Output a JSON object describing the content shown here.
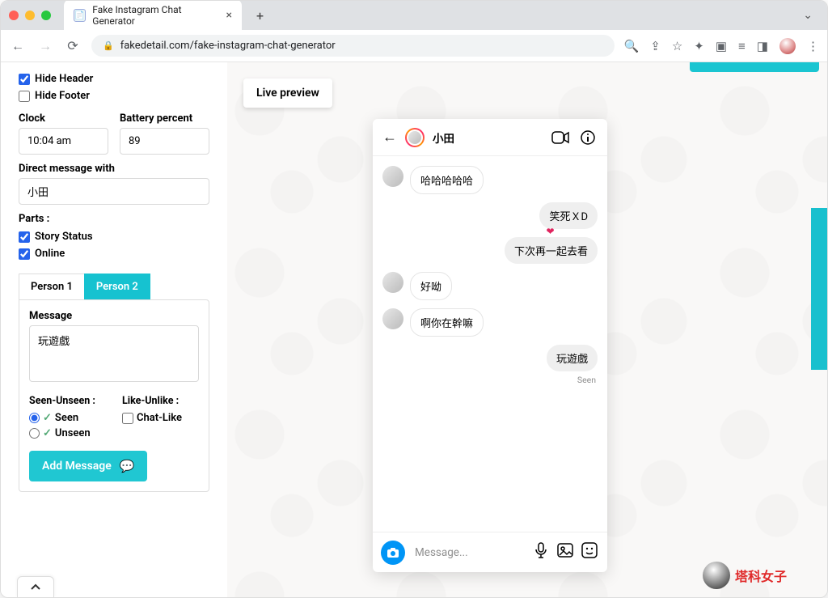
{
  "browser": {
    "tab_title": "Fake Instagram Chat Generator",
    "url_display": "fakedetail.com/fake-instagram-chat-generator"
  },
  "sidebar": {
    "hide_header_label": "Hide Header",
    "hide_header_checked": true,
    "hide_footer_label": "Hide Footer",
    "hide_footer_checked": false,
    "clock_label": "Clock",
    "clock_value": "10:04 am",
    "battery_label": "Battery percent",
    "battery_value": "89",
    "dm_label": "Direct message with",
    "dm_value": "小田",
    "parts_label": "Parts :",
    "story_status_label": "Story Status",
    "story_status_checked": true,
    "online_label": "Online",
    "online_checked": true,
    "tabs": {
      "person1": "Person 1",
      "person2": "Person 2",
      "active": "person2"
    },
    "message_label": "Message",
    "message_value": "玩遊戲",
    "seen_unseen_label": "Seen-Unseen :",
    "seen_label": "Seen",
    "unseen_label": "Unseen",
    "seen_selected": "seen",
    "like_unlike_label": "Like-Unlike :",
    "chat_like_label": "Chat-Like",
    "chat_like_checked": false,
    "add_message_label": "Add Message"
  },
  "preview": {
    "live_preview_label": "Live preview",
    "contact_name": "小田",
    "messages": [
      {
        "side": "in",
        "text": "哈哈哈哈哈"
      },
      {
        "side": "out",
        "text": "笑死ＸD",
        "liked": true
      },
      {
        "side": "out",
        "text": "下次再一起去看"
      },
      {
        "side": "in",
        "text": "好呦"
      },
      {
        "side": "in",
        "text": "啊你在幹嘛"
      },
      {
        "side": "out",
        "text": "玩遊戲"
      }
    ],
    "seen_text": "Seen",
    "input_placeholder": "Message..."
  },
  "brand": {
    "text": "塔科女子"
  },
  "colors": {
    "accent": "#16c2d0",
    "ig_blue": "#0095f6"
  }
}
